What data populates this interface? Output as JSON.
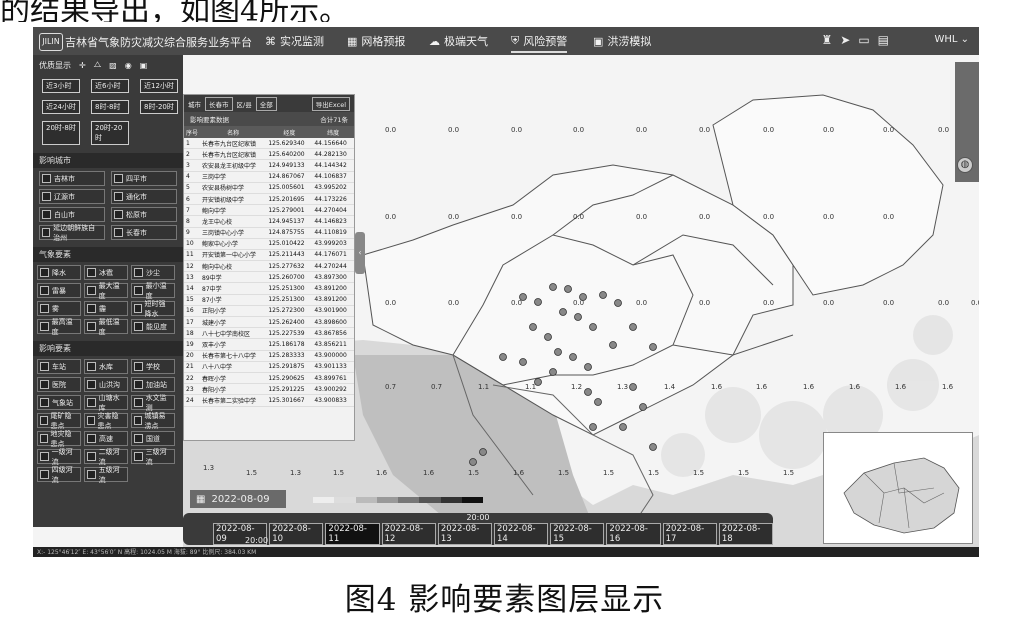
{
  "top_text": "的结果导出，如图4所示。",
  "caption": "图4  影响要素图层显示",
  "app": {
    "logo": "JILIN",
    "title": "吉林省气象防灾减灾综合服务业务平台",
    "nav": [
      {
        "label": "实况监测",
        "icon": "⌘"
      },
      {
        "label": "网格预报",
        "icon": "▦"
      },
      {
        "label": "极端天气",
        "icon": "☁"
      },
      {
        "label": "风险预警",
        "icon": "⛨"
      },
      {
        "label": "洪涝模拟",
        "icon": "▣"
      }
    ],
    "user": "WHL ⌄"
  },
  "left_panel": {
    "tab_label": "优质显示",
    "time_buttons": [
      "近3小时",
      "近6小时",
      "近12小时",
      "近24小时",
      "8时-8时",
      "8时-20时",
      "20时-8时",
      "20时-20时"
    ],
    "sec_cities": "影响城市",
    "cities": [
      "吉林市",
      "四平市",
      "辽源市",
      "通化市",
      "白山市",
      "松原市",
      "延边朝鲜族自治州",
      "长春市"
    ],
    "sec_weather": "气象要素",
    "weather": [
      "降水",
      "冰雹",
      "沙尘",
      "雷暴",
      "最大温度",
      "最小温度",
      "雾",
      "霾",
      "短时强降水",
      "最高温度",
      "最低温度",
      "能见度"
    ],
    "sec_impact": "影响要素",
    "impact": [
      "车站",
      "水库",
      "学校",
      "医院",
      "山洪沟",
      "加油站",
      "气象站",
      "山塘水库",
      "水文监测",
      "尾矿隐患点",
      "灾害隐患点",
      "城镇易涝点",
      "地灾隐患点",
      "高速",
      "国道",
      "一级河流",
      "二级河流",
      "三级河流",
      "四级河流",
      "五级河流"
    ]
  },
  "station": {
    "city_label": "城市",
    "city_value": "长春市",
    "district_label": "区/县",
    "district_value": "全部",
    "export": "导出Excel",
    "subtitle": "影响要素数据",
    "total": "合计71条",
    "headers": [
      "序号",
      "名称",
      "经度",
      "纬度"
    ],
    "rows": [
      [
        "1",
        "长春市九台区纪家镇",
        "125.629340",
        "44.156640"
      ],
      [
        "2",
        "长春市九台区纪家镇",
        "125.640200",
        "44.282130"
      ],
      [
        "3",
        "农安县龙王初级中学",
        "124.949133",
        "44.144342"
      ],
      [
        "4",
        "三岗中学",
        "124.867067",
        "44.106837"
      ],
      [
        "5",
        "农安县杨树中学",
        "125.005601",
        "43.995202"
      ],
      [
        "6",
        "开安镇初级中学",
        "125.201695",
        "44.173226"
      ],
      [
        "7",
        "鲍向中学",
        "125.279001",
        "44.270404"
      ],
      [
        "8",
        "龙王中心校",
        "124.945137",
        "44.146823"
      ],
      [
        "9",
        "三岗镇中心小学",
        "124.875755",
        "44.110819"
      ],
      [
        "10",
        "鲍家中心小学",
        "125.010422",
        "43.999203"
      ],
      [
        "11",
        "开安镇第一中心小学",
        "125.211443",
        "44.176071"
      ],
      [
        "12",
        "鲍向中心校",
        "125.277632",
        "44.270244"
      ],
      [
        "13",
        "89中学",
        "125.260700",
        "43.897300"
      ],
      [
        "14",
        "87中学",
        "125.251300",
        "43.891200"
      ],
      [
        "15",
        "87小学",
        "125.251300",
        "43.891200"
      ],
      [
        "16",
        "正阳小学",
        "125.272300",
        "43.901900"
      ],
      [
        "17",
        "城建小学",
        "125.262400",
        "43.898600"
      ],
      [
        "18",
        "八十七中学南校区",
        "125.227539",
        "43.867856"
      ],
      [
        "19",
        "双丰小学",
        "125.186178",
        "43.856211"
      ],
      [
        "20",
        "长春市第七十八中学",
        "125.283333",
        "43.900000"
      ],
      [
        "21",
        "八十八中学",
        "125.291875",
        "43.901133"
      ],
      [
        "22",
        "春晖小学",
        "125.290625",
        "43.899761"
      ],
      [
        "23",
        "春阳小学",
        "125.291225",
        "43.900292"
      ],
      [
        "24",
        "长春市第二实验中学",
        "125.301667",
        "43.900833"
      ]
    ]
  },
  "map_values": [
    {
      "v": "0.0"
    },
    {
      "v": "0.0"
    },
    {
      "v": "0.0"
    },
    {
      "v": "0.0"
    },
    {
      "v": "0.0"
    },
    {
      "v": "0.0"
    },
    {
      "v": "0.0"
    },
    {
      "v": "0.0"
    },
    {
      "v": "0.0"
    },
    {
      "v": "0.0"
    },
    {
      "v": "0.0"
    },
    {
      "v": "0.0"
    },
    {
      "v": "0.0"
    },
    {
      "v": "0.0"
    },
    {
      "v": "0.0"
    },
    {
      "v": "0.0"
    },
    {
      "v": "0.0"
    },
    {
      "v": "0.0"
    },
    {
      "v": "0.0"
    },
    {
      "v": "0.0"
    },
    {
      "v": "0.0"
    },
    {
      "v": "0.0"
    },
    {
      "v": "0.0"
    },
    {
      "v": "0.0"
    },
    {
      "v": "0.0"
    },
    {
      "v": "0.0"
    },
    {
      "v": "0.0"
    },
    {
      "v": "0.0"
    },
    {
      "v": "0.0"
    },
    {
      "v": "0.0"
    },
    {
      "v": "0.0"
    },
    {
      "v": "0.0"
    },
    {
      "v": "0.7"
    },
    {
      "v": "0.7"
    },
    {
      "v": "1.1"
    },
    {
      "v": "1.1"
    },
    {
      "v": "1.2"
    },
    {
      "v": "1.3"
    },
    {
      "v": "1.4"
    },
    {
      "v": "1.6"
    },
    {
      "v": "1.6"
    },
    {
      "v": "1.6"
    },
    {
      "v": "1.6"
    },
    {
      "v": "1.6"
    },
    {
      "v": "1.6"
    },
    {
      "v": "1.3"
    },
    {
      "v": "1.5"
    },
    {
      "v": "1.3"
    },
    {
      "v": "1.5"
    },
    {
      "v": "1.6"
    },
    {
      "v": "1.6"
    },
    {
      "v": "1.5"
    },
    {
      "v": "1.6"
    },
    {
      "v": "1.5"
    },
    {
      "v": "1.5"
    },
    {
      "v": "1.5"
    },
    {
      "v": "1.5"
    },
    {
      "v": "1.5"
    },
    {
      "v": "1.5"
    },
    {
      "v": "1.5"
    },
    {
      "v": "1.4"
    }
  ],
  "date_box": "2022-08-09",
  "timeline": {
    "top": "20:00",
    "dates": [
      "2022-08-09",
      "2022-08-10",
      "2022-08-11",
      "2022-08-12",
      "2022-08-13",
      "2022-08-14",
      "2022-08-15",
      "2022-08-16",
      "2022-08-17",
      "2022-08-18"
    ],
    "current_index": 2,
    "bottom": "20:00"
  },
  "statusbar": "X:- 125°46′12″  E:  43°56′0″  N  高程: 1024.05 M  海拔: 89°  比例尺:  384.03 KM",
  "colors": {
    "header": "#4a4a4a",
    "panel": "#3a3a3a",
    "map_land": "#f7f7f7",
    "map_shade": "#cfcfcf"
  }
}
